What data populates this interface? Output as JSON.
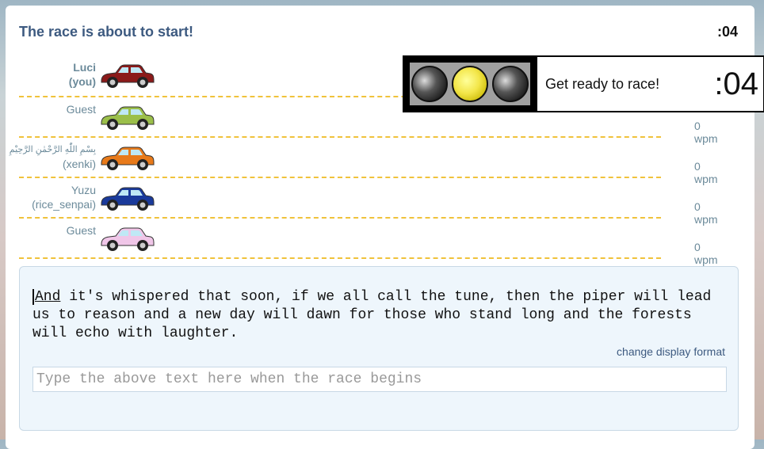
{
  "header": {
    "title": "The race is about to start!",
    "timer": ":04"
  },
  "racers": [
    {
      "name": "Luci",
      "handle": "(you)",
      "wpm": "",
      "car_color": "#8b1a1a",
      "is_you": true
    },
    {
      "name": "Guest",
      "handle": "",
      "wpm": "0 wpm",
      "car_color": "#9bbf4a",
      "is_you": false
    },
    {
      "name": "بِسْمِ اللّٰهِ الرَّحْمٰنِ الرَّحِيْمِ",
      "handle": "(xenki)",
      "wpm": "0 wpm",
      "car_color": "#e87a1a",
      "is_you": false
    },
    {
      "name": "Yuzu",
      "handle": "(rice_senpai)",
      "wpm": "0 wpm",
      "car_color": "#1a3a9b",
      "is_you": false
    },
    {
      "name": "Guest",
      "handle": "",
      "wpm": "0 wpm",
      "car_color": "#f0c6e8",
      "is_you": false
    }
  ],
  "signal": {
    "message": "Get ready to race!",
    "countdown": ":04",
    "lights": [
      "off",
      "on",
      "off"
    ],
    "active_color": "#f3e64a"
  },
  "race_text": {
    "current_word": "And",
    "rest": " it's whispered that soon, if we all call the tune, then the piper will lead us to reason and a new day will dawn for those who stand long and the forests will echo with laughter."
  },
  "change_format_label": "change display format",
  "input": {
    "placeholder": "Type the above text here when the race begins",
    "value": ""
  },
  "colors": {
    "accent": "#3d5a80",
    "lane_divider": "#f0c23b",
    "text_box_bg": "#eef6fc"
  }
}
